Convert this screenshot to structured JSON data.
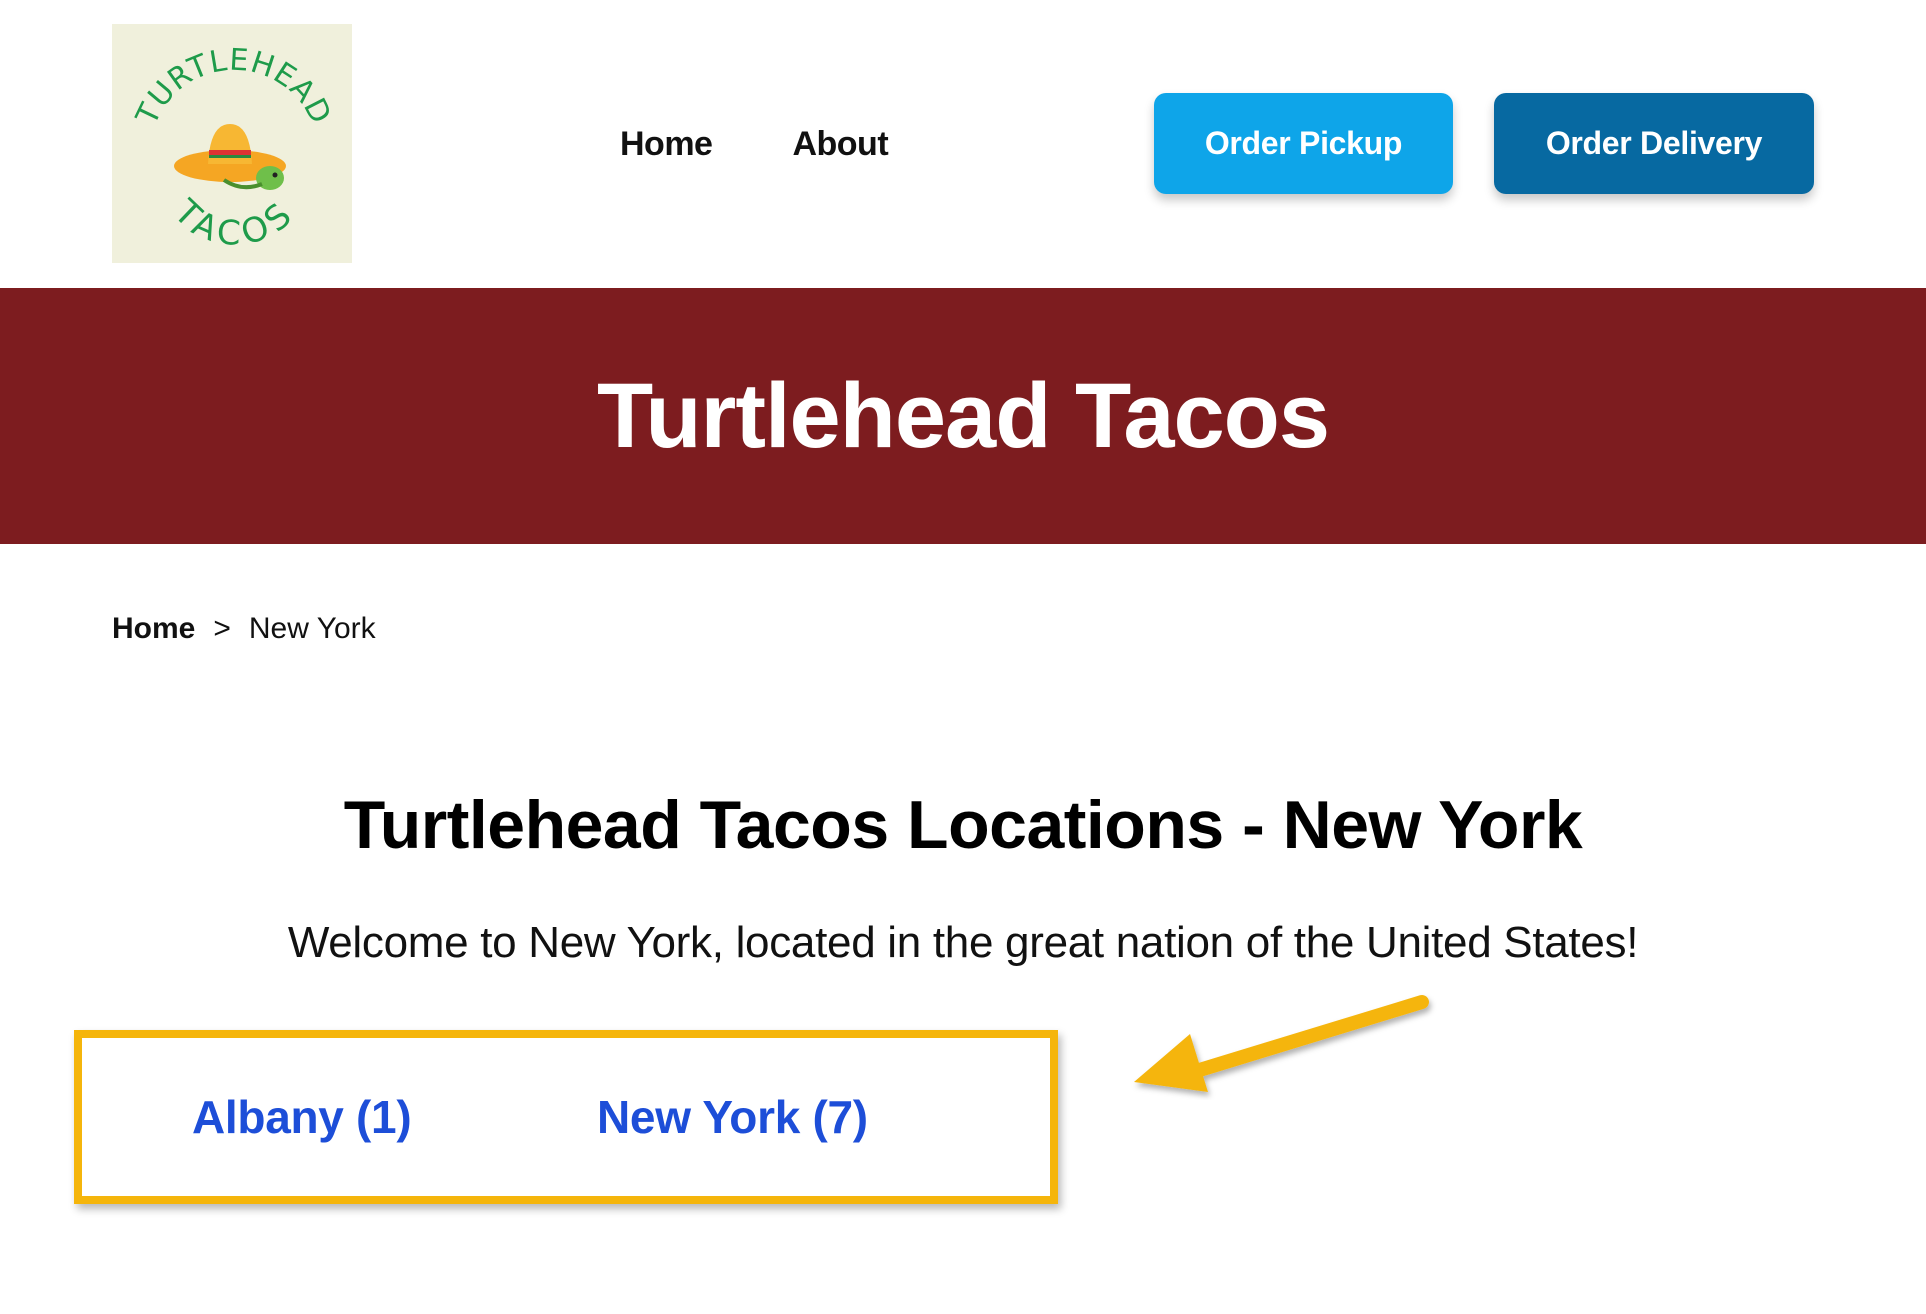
{
  "header": {
    "logo": {
      "text_top": "TURTLEHEAD",
      "text_bottom": "TACOS",
      "icon": "sombrero-turtle-icon"
    },
    "nav": [
      {
        "label": "Home"
      },
      {
        "label": "About"
      }
    ],
    "order_pickup_label": "Order Pickup",
    "order_delivery_label": "Order Delivery"
  },
  "hero": {
    "title": "Turtlehead Tacos"
  },
  "breadcrumb": {
    "home": "Home",
    "separator": ">",
    "current": "New York"
  },
  "main": {
    "title": "Turtlehead Tacos Locations - New York",
    "welcome": "Welcome to New York, located in the great nation of the United States!",
    "cities": [
      {
        "label": "Albany (1)"
      },
      {
        "label": "New York (7)"
      }
    ]
  },
  "colors": {
    "hero_bg": "#7d1c1f",
    "pickup_btn": "#0ea5e9",
    "delivery_btn": "#0769a1",
    "link_blue": "#1d4ed8",
    "highlight": "#f5b50b",
    "logo_bg": "#f0f0dc",
    "logo_green": "#1e9b4a"
  },
  "annotation": {
    "arrow_icon": "arrow-left-icon"
  }
}
